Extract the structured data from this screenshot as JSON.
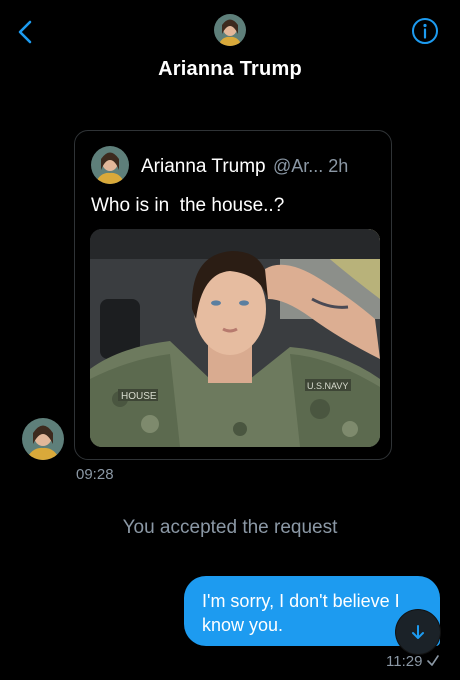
{
  "header": {
    "title": "Arianna Trump",
    "back_icon": "chevron-left-icon",
    "info_icon": "info-icon"
  },
  "tweet": {
    "author": "Arianna Trump",
    "handle_time": "@Ar... 2h",
    "text": "Who is in  the house..?"
  },
  "messages": {
    "incoming_time": "09:28",
    "status": "You accepted the request",
    "outgoing_text": "I'm sorry, I don't believe I know you.",
    "outgoing_time": "11:29"
  },
  "colors": {
    "accent": "#1d9bf0",
    "background": "#000000",
    "muted": "#8b98a5"
  }
}
